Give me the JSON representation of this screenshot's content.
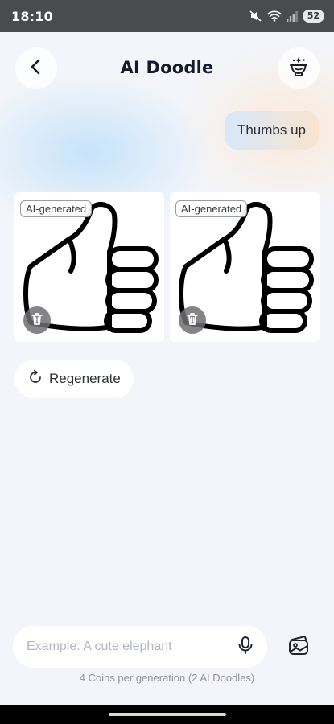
{
  "status_bar": {
    "time": "18:10",
    "battery": "52",
    "icons": [
      "mute-icon",
      "wifi-icon",
      "signal-icon",
      "battery-icon"
    ]
  },
  "header": {
    "title": "AI Doodle",
    "back_icon": "chevron-left-icon",
    "action_icon": "bowl-sparkle-icon"
  },
  "conversation": {
    "user_message": "Thumbs up"
  },
  "results": {
    "items": [
      {
        "tag": "AI-generated",
        "image": "thumbs-up-doodle",
        "delete_icon": "trash-icon"
      },
      {
        "tag": "AI-generated",
        "image": "thumbs-up-doodle",
        "delete_icon": "trash-icon"
      }
    ],
    "regenerate_label": "Regenerate",
    "regenerate_icon": "refresh-icon"
  },
  "composer": {
    "placeholder": "Example: A cute elephant",
    "mic_icon": "microphone-icon",
    "gallery_icon": "image-gallery-icon",
    "coins_note": "4 Coins per generation (2 AI Doodles)"
  },
  "colors": {
    "background": "#f3f5fa",
    "title": "#161a2b",
    "bubble_gradient_start": "#d7e8fb",
    "bubble_gradient_end": "#f9e4cf"
  }
}
